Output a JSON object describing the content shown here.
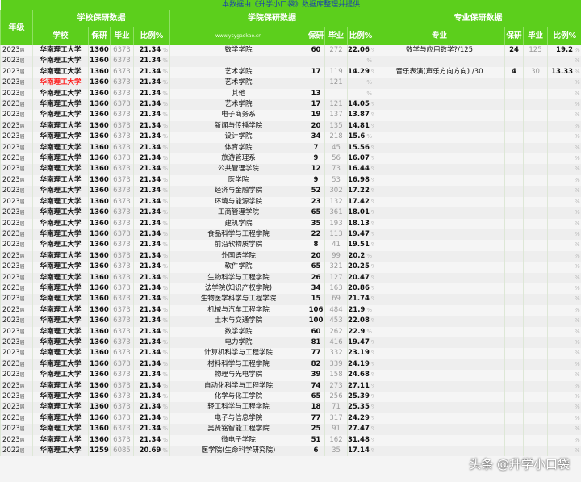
{
  "banner": "本数据由《升学小口袋》数据库整理并提供",
  "headers": {
    "year": "年级",
    "school_group": "学校保研数据",
    "college_group": "学院保研数据",
    "major_group": "专业保研数据",
    "school": "学校",
    "college_site": "www.ysygaokao.cn",
    "major": "专业",
    "baoyan": "保研",
    "biye": "毕业",
    "ratio": "比例%"
  },
  "pct_sign": "%",
  "rows": [
    {
      "year": "2023",
      "suffix": "届",
      "school": "华南理工大学",
      "s_by": "1360",
      "s_grad": "6373",
      "s_ratio": "21.34",
      "college": "数学学院",
      "c_by": "60",
      "c_grad": "272",
      "c_ratio": "22.06",
      "major": "数学与应用数学?/125",
      "m_by": "24",
      "m_grad": "125",
      "m_ratio": "19.2"
    },
    {
      "year": "2023",
      "suffix": "届",
      "school": "华南理工大学",
      "s_by": "1360",
      "s_grad": "6373",
      "s_ratio": "21.34",
      "college": "",
      "c_by": "",
      "c_grad": "",
      "c_ratio": "",
      "major": "",
      "m_by": "",
      "m_grad": "",
      "m_ratio": ""
    },
    {
      "year": "2023",
      "suffix": "届",
      "school": "华南理工大学",
      "s_by": "1360",
      "s_grad": "6373",
      "s_ratio": "21.34",
      "college": "艺术学院",
      "c_by": "17",
      "c_grad": "119",
      "c_ratio": "14.29",
      "major": "音乐表演(声乐方向方向) /30",
      "m_by": "4",
      "m_grad": "30",
      "m_ratio": "13.33"
    },
    {
      "year": "2023",
      "suffix": "届",
      "school": "华南理工大学",
      "red": true,
      "s_by": "1360",
      "s_grad": "6373",
      "s_ratio": "21.34",
      "college": "艺术学院",
      "c_by": "",
      "c_grad": "121",
      "c_ratio": "",
      "major": "",
      "m_by": "",
      "m_grad": "",
      "m_ratio": ""
    },
    {
      "year": "2023",
      "suffix": "届",
      "school": "华南理工大学",
      "s_by": "1360",
      "s_grad": "6373",
      "s_ratio": "21.34",
      "college": "其他",
      "c_by": "13",
      "c_grad": "",
      "c_ratio": "",
      "major": "",
      "m_by": "",
      "m_grad": "",
      "m_ratio": ""
    },
    {
      "year": "2023",
      "suffix": "届",
      "school": "华南理工大学",
      "s_by": "1360",
      "s_grad": "6373",
      "s_ratio": "21.34",
      "college": "艺术学院",
      "c_by": "17",
      "c_grad": "121",
      "c_ratio": "14.05",
      "major": "",
      "m_by": "",
      "m_grad": "",
      "m_ratio": ""
    },
    {
      "year": "2023",
      "suffix": "届",
      "school": "华南理工大学",
      "s_by": "1360",
      "s_grad": "6373",
      "s_ratio": "21.34",
      "college": "电子商务系",
      "c_by": "19",
      "c_grad": "137",
      "c_ratio": "13.87",
      "major": "",
      "m_by": "",
      "m_grad": "",
      "m_ratio": ""
    },
    {
      "year": "2023",
      "suffix": "届",
      "school": "华南理工大学",
      "s_by": "1360",
      "s_grad": "6373",
      "s_ratio": "21.34",
      "college": "新闻与传播学院",
      "c_by": "20",
      "c_grad": "135",
      "c_ratio": "14.81",
      "major": "",
      "m_by": "",
      "m_grad": "",
      "m_ratio": ""
    },
    {
      "year": "2023",
      "suffix": "届",
      "school": "华南理工大学",
      "s_by": "1360",
      "s_grad": "6373",
      "s_ratio": "21.34",
      "college": "设计学院",
      "c_by": "34",
      "c_grad": "218",
      "c_ratio": "15.6",
      "major": "",
      "m_by": "",
      "m_grad": "",
      "m_ratio": ""
    },
    {
      "year": "2023",
      "suffix": "届",
      "school": "华南理工大学",
      "s_by": "1360",
      "s_grad": "6373",
      "s_ratio": "21.34",
      "college": "体育学院",
      "c_by": "7",
      "c_grad": "45",
      "c_ratio": "15.56",
      "major": "",
      "m_by": "",
      "m_grad": "",
      "m_ratio": ""
    },
    {
      "year": "2023",
      "suffix": "届",
      "school": "华南理工大学",
      "s_by": "1360",
      "s_grad": "6373",
      "s_ratio": "21.34",
      "college": "旅游管理系",
      "c_by": "9",
      "c_grad": "56",
      "c_ratio": "16.07",
      "major": "",
      "m_by": "",
      "m_grad": "",
      "m_ratio": ""
    },
    {
      "year": "2023",
      "suffix": "届",
      "school": "华南理工大学",
      "s_by": "1360",
      "s_grad": "6373",
      "s_ratio": "21.34",
      "college": "公共管理学院",
      "c_by": "12",
      "c_grad": "73",
      "c_ratio": "16.44",
      "major": "",
      "m_by": "",
      "m_grad": "",
      "m_ratio": ""
    },
    {
      "year": "2023",
      "suffix": "届",
      "school": "华南理工大学",
      "s_by": "1360",
      "s_grad": "6373",
      "s_ratio": "21.34",
      "college": "医学院",
      "c_by": "9",
      "c_grad": "53",
      "c_ratio": "16.98",
      "major": "",
      "m_by": "",
      "m_grad": "",
      "m_ratio": ""
    },
    {
      "year": "2023",
      "suffix": "届",
      "school": "华南理工大学",
      "s_by": "1360",
      "s_grad": "6373",
      "s_ratio": "21.34",
      "college": "经济与金融学院",
      "c_by": "52",
      "c_grad": "302",
      "c_ratio": "17.22",
      "major": "",
      "m_by": "",
      "m_grad": "",
      "m_ratio": ""
    },
    {
      "year": "2023",
      "suffix": "届",
      "school": "华南理工大学",
      "s_by": "1360",
      "s_grad": "6373",
      "s_ratio": "21.34",
      "college": "环境与能源学院",
      "c_by": "23",
      "c_grad": "132",
      "c_ratio": "17.42",
      "major": "",
      "m_by": "",
      "m_grad": "",
      "m_ratio": ""
    },
    {
      "year": "2023",
      "suffix": "届",
      "school": "华南理工大学",
      "s_by": "1360",
      "s_grad": "6373",
      "s_ratio": "21.34",
      "college": "工商管理学院",
      "c_by": "65",
      "c_grad": "361",
      "c_ratio": "18.01",
      "major": "",
      "m_by": "",
      "m_grad": "",
      "m_ratio": ""
    },
    {
      "year": "2023",
      "suffix": "届",
      "school": "华南理工大学",
      "s_by": "1360",
      "s_grad": "6373",
      "s_ratio": "21.34",
      "college": "建筑学院",
      "c_by": "35",
      "c_grad": "193",
      "c_ratio": "18.13",
      "major": "",
      "m_by": "",
      "m_grad": "",
      "m_ratio": ""
    },
    {
      "year": "2023",
      "suffix": "届",
      "school": "华南理工大学",
      "s_by": "1360",
      "s_grad": "6373",
      "s_ratio": "21.34",
      "college": "食品科学与工程学院",
      "c_by": "22",
      "c_grad": "113",
      "c_ratio": "19.47",
      "major": "",
      "m_by": "",
      "m_grad": "",
      "m_ratio": ""
    },
    {
      "year": "2023",
      "suffix": "届",
      "school": "华南理工大学",
      "s_by": "1360",
      "s_grad": "6373",
      "s_ratio": "21.34",
      "college": "前沿软物质学院",
      "c_by": "8",
      "c_grad": "41",
      "c_ratio": "19.51",
      "major": "",
      "m_by": "",
      "m_grad": "",
      "m_ratio": ""
    },
    {
      "year": "2023",
      "suffix": "届",
      "school": "华南理工大学",
      "s_by": "1360",
      "s_grad": "6373",
      "s_ratio": "21.34",
      "college": "外国语学院",
      "c_by": "20",
      "c_grad": "99",
      "c_ratio": "20.2",
      "major": "",
      "m_by": "",
      "m_grad": "",
      "m_ratio": ""
    },
    {
      "year": "2023",
      "suffix": "届",
      "school": "华南理工大学",
      "s_by": "1360",
      "s_grad": "6373",
      "s_ratio": "21.34",
      "college": "软件学院",
      "c_by": "65",
      "c_grad": "321",
      "c_ratio": "20.25",
      "major": "",
      "m_by": "",
      "m_grad": "",
      "m_ratio": ""
    },
    {
      "year": "2023",
      "suffix": "届",
      "school": "华南理工大学",
      "s_by": "1360",
      "s_grad": "6373",
      "s_ratio": "21.34",
      "college": "生物科学与工程学院",
      "c_by": "26",
      "c_grad": "127",
      "c_ratio": "20.47",
      "major": "",
      "m_by": "",
      "m_grad": "",
      "m_ratio": ""
    },
    {
      "year": "2023",
      "suffix": "届",
      "school": "华南理工大学",
      "s_by": "1360",
      "s_grad": "6373",
      "s_ratio": "21.34",
      "college": "法学院(知识产权学院)",
      "c_by": "34",
      "c_grad": "163",
      "c_ratio": "20.86",
      "major": "",
      "m_by": "",
      "m_grad": "",
      "m_ratio": ""
    },
    {
      "year": "2023",
      "suffix": "届",
      "school": "华南理工大学",
      "s_by": "1360",
      "s_grad": "6373",
      "s_ratio": "21.34",
      "college": "生物医学科学与工程学院",
      "c_by": "15",
      "c_grad": "69",
      "c_ratio": "21.74",
      "major": "",
      "m_by": "",
      "m_grad": "",
      "m_ratio": ""
    },
    {
      "year": "2023",
      "suffix": "届",
      "school": "华南理工大学",
      "s_by": "1360",
      "s_grad": "6373",
      "s_ratio": "21.34",
      "college": "机械与汽车工程学院",
      "c_by": "106",
      "c_grad": "484",
      "c_ratio": "21.9",
      "major": "",
      "m_by": "",
      "m_grad": "",
      "m_ratio": ""
    },
    {
      "year": "2023",
      "suffix": "届",
      "school": "华南理工大学",
      "s_by": "1360",
      "s_grad": "6373",
      "s_ratio": "21.34",
      "college": "土木与交通学院",
      "c_by": "100",
      "c_grad": "453",
      "c_ratio": "22.08",
      "major": "",
      "m_by": "",
      "m_grad": "",
      "m_ratio": ""
    },
    {
      "year": "2023",
      "suffix": "届",
      "school": "华南理工大学",
      "s_by": "1360",
      "s_grad": "6373",
      "s_ratio": "21.34",
      "college": "数学学院",
      "c_by": "60",
      "c_grad": "262",
      "c_ratio": "22.9",
      "major": "",
      "m_by": "",
      "m_grad": "",
      "m_ratio": ""
    },
    {
      "year": "2023",
      "suffix": "届",
      "school": "华南理工大学",
      "s_by": "1360",
      "s_grad": "6373",
      "s_ratio": "21.34",
      "college": "电力学院",
      "c_by": "81",
      "c_grad": "416",
      "c_ratio": "19.47",
      "major": "",
      "m_by": "",
      "m_grad": "",
      "m_ratio": ""
    },
    {
      "year": "2023",
      "suffix": "届",
      "school": "华南理工大学",
      "s_by": "1360",
      "s_grad": "6373",
      "s_ratio": "21.34",
      "college": "计算机科学与工程学院",
      "c_by": "77",
      "c_grad": "332",
      "c_ratio": "23.19",
      "major": "",
      "m_by": "",
      "m_grad": "",
      "m_ratio": ""
    },
    {
      "year": "2023",
      "suffix": "届",
      "school": "华南理工大学",
      "s_by": "1360",
      "s_grad": "6373",
      "s_ratio": "21.34",
      "college": "材料科学与工程学院",
      "c_by": "82",
      "c_grad": "339",
      "c_ratio": "24.19",
      "major": "",
      "m_by": "",
      "m_grad": "",
      "m_ratio": ""
    },
    {
      "year": "2023",
      "suffix": "届",
      "school": "华南理工大学",
      "s_by": "1360",
      "s_grad": "6373",
      "s_ratio": "21.34",
      "college": "物理与光电学院",
      "c_by": "39",
      "c_grad": "158",
      "c_ratio": "24.68",
      "major": "",
      "m_by": "",
      "m_grad": "",
      "m_ratio": ""
    },
    {
      "year": "2023",
      "suffix": "届",
      "school": "华南理工大学",
      "s_by": "1360",
      "s_grad": "6373",
      "s_ratio": "21.34",
      "college": "自动化科学与工程学院",
      "c_by": "74",
      "c_grad": "273",
      "c_ratio": "27.11",
      "major": "",
      "m_by": "",
      "m_grad": "",
      "m_ratio": ""
    },
    {
      "year": "2023",
      "suffix": "届",
      "school": "华南理工大学",
      "s_by": "1360",
      "s_grad": "6373",
      "s_ratio": "21.34",
      "college": "化学与化工学院",
      "c_by": "65",
      "c_grad": "256",
      "c_ratio": "25.39",
      "major": "",
      "m_by": "",
      "m_grad": "",
      "m_ratio": ""
    },
    {
      "year": "2023",
      "suffix": "届",
      "school": "华南理工大学",
      "s_by": "1360",
      "s_grad": "6373",
      "s_ratio": "21.34",
      "college": "轻工科学与工程学院",
      "c_by": "18",
      "c_grad": "71",
      "c_ratio": "25.35",
      "major": "",
      "m_by": "",
      "m_grad": "",
      "m_ratio": ""
    },
    {
      "year": "2023",
      "suffix": "届",
      "school": "华南理工大学",
      "s_by": "1360",
      "s_grad": "6373",
      "s_ratio": "21.34",
      "college": "电子与信息学院",
      "c_by": "77",
      "c_grad": "317",
      "c_ratio": "24.29",
      "major": "",
      "m_by": "",
      "m_grad": "",
      "m_ratio": ""
    },
    {
      "year": "2023",
      "suffix": "届",
      "school": "华南理工大学",
      "s_by": "1360",
      "s_grad": "6373",
      "s_ratio": "21.34",
      "college": "吴贤铭智能工程学院",
      "c_by": "25",
      "c_grad": "91",
      "c_ratio": "27.47",
      "major": "",
      "m_by": "",
      "m_grad": "",
      "m_ratio": ""
    },
    {
      "year": "2023",
      "suffix": "届",
      "school": "华南理工大学",
      "s_by": "1360",
      "s_grad": "6373",
      "s_ratio": "21.34",
      "college": "微电子学院",
      "c_by": "51",
      "c_grad": "162",
      "c_ratio": "31.48",
      "major": "",
      "m_by": "",
      "m_grad": "",
      "m_ratio": ""
    },
    {
      "year": "2022",
      "suffix": "届",
      "school": "华南理工大学",
      "s_by": "1259",
      "s_grad": "6085",
      "s_ratio": "20.69",
      "college": "医学院(生命科学研究院)",
      "c_by": "6",
      "c_grad": "35",
      "c_ratio": "17.14",
      "major": "",
      "m_by": "",
      "m_grad": "",
      "m_ratio": ""
    }
  ],
  "watermark": "头条 @升学小口袋"
}
